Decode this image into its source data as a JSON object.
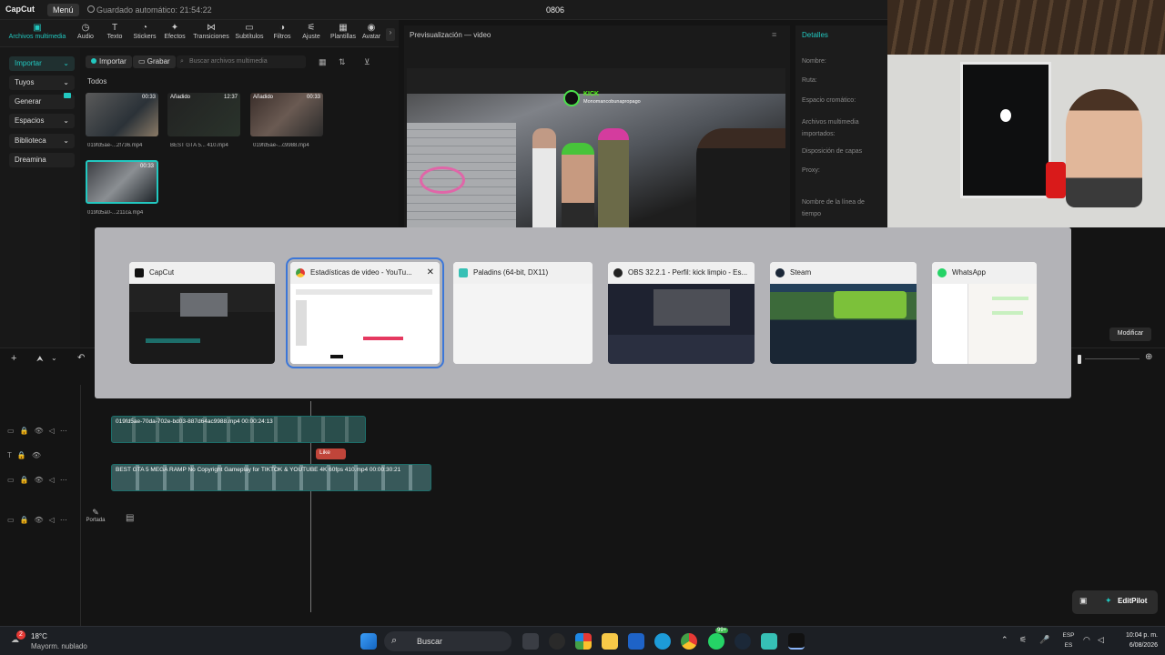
{
  "topbar": {
    "app_name": "CapCut",
    "menu_label": "Menú",
    "autosave": "Guardado automático: 21:54:22",
    "project_title": "0806"
  },
  "toolbar": {
    "tools": [
      {
        "label": "Archivos multimedia",
        "icon": "media-icon"
      },
      {
        "label": "Audio",
        "icon": "audio-icon"
      },
      {
        "label": "Texto",
        "icon": "text-icon"
      },
      {
        "label": "Stickers",
        "icon": "sticker-icon"
      },
      {
        "label": "Efectos",
        "icon": "effects-icon"
      },
      {
        "label": "Transiciones",
        "icon": "transition-icon"
      },
      {
        "label": "Subtítulos",
        "icon": "subtitle-icon"
      },
      {
        "label": "Filtros",
        "icon": "filter-icon"
      },
      {
        "label": "Ajuste",
        "icon": "adjust-icon"
      },
      {
        "label": "Plantillas",
        "icon": "template-icon"
      },
      {
        "label": "Avatar",
        "icon": "avatar-icon"
      }
    ]
  },
  "leftnav": {
    "items": [
      "Importar",
      "Tuyos",
      "Generar",
      "Espacios",
      "Biblioteca",
      "Dreamina"
    ]
  },
  "media": {
    "import_label": "Importar",
    "record_label": "Grabar",
    "search_placeholder": "Buscar archivos multimedia",
    "section_label": "Todos",
    "items": [
      {
        "name": "019fd5ae-...2f736.mp4",
        "duration": "00:33",
        "tag": ""
      },
      {
        "name": "BEST GTA 5... 410.mp4",
        "duration": "12:37",
        "tag": "Añadido"
      },
      {
        "name": "019fd5ae-...c9988.mp4",
        "duration": "00:33",
        "tag": "Añadido"
      },
      {
        "name": "019fd5a0-...211ca.mp4",
        "duration": "00:33",
        "tag": ""
      }
    ]
  },
  "preview": {
    "title": "Previsualización — video",
    "overlay_brand": "KICK",
    "overlay_user": "Monomancobunapropago"
  },
  "details": {
    "title": "Detalles",
    "fields": [
      "Nombre:",
      "Ruta:",
      "Espacio cromático:",
      "Archivos multimedia importados:",
      "Disposición de capas",
      "Proxy:",
      "Nombre de la línea de tiempo"
    ]
  },
  "switcher": {
    "windows": [
      {
        "title": "CapCut",
        "icon": "capcut-icon"
      },
      {
        "title": "Estadísticas de video - YouTu...",
        "icon": "chrome-icon",
        "selected": true,
        "close": "✕"
      },
      {
        "title": "Paladins (64-bit, DX11)",
        "icon": "paladins-icon"
      },
      {
        "title": "OBS 32.2.1 - Perfil: kick limpio - Es...",
        "icon": "obs-icon"
      },
      {
        "title": "Steam",
        "icon": "steam-icon"
      },
      {
        "title": "WhatsApp",
        "icon": "whatsapp-icon"
      }
    ]
  },
  "editor_right": {
    "modify_label": "Modificar"
  },
  "timeline": {
    "clips": [
      {
        "label": "019fd5ae-70da-702e-bd03-887d64ac9988.mp4   00:00:24:13"
      },
      {
        "label": "Like"
      },
      {
        "label": "BEST GTA 5 MEGA RAMP No Copyright Gameplay for TIKTOK & YOUTUBE 4K 60fps   410.mp4   00:00:30:21"
      }
    ],
    "cover_label": "Portada"
  },
  "editpilot": {
    "label": "EditPilot"
  },
  "taskbar": {
    "weather_temp": "18°C",
    "weather_desc": "Mayorm. nublado",
    "search_label": "Buscar",
    "notif_count": "2",
    "badge_count": "99+",
    "lang": "ESP",
    "lang_sub": "ES",
    "time": "10:04 p. m.",
    "date": "6/08/2026"
  },
  "colors": {
    "accent": "#22c8c0",
    "selection": "#3b76d8",
    "clip_teal": "#1d6e6a",
    "like_clip": "#c0453a"
  }
}
